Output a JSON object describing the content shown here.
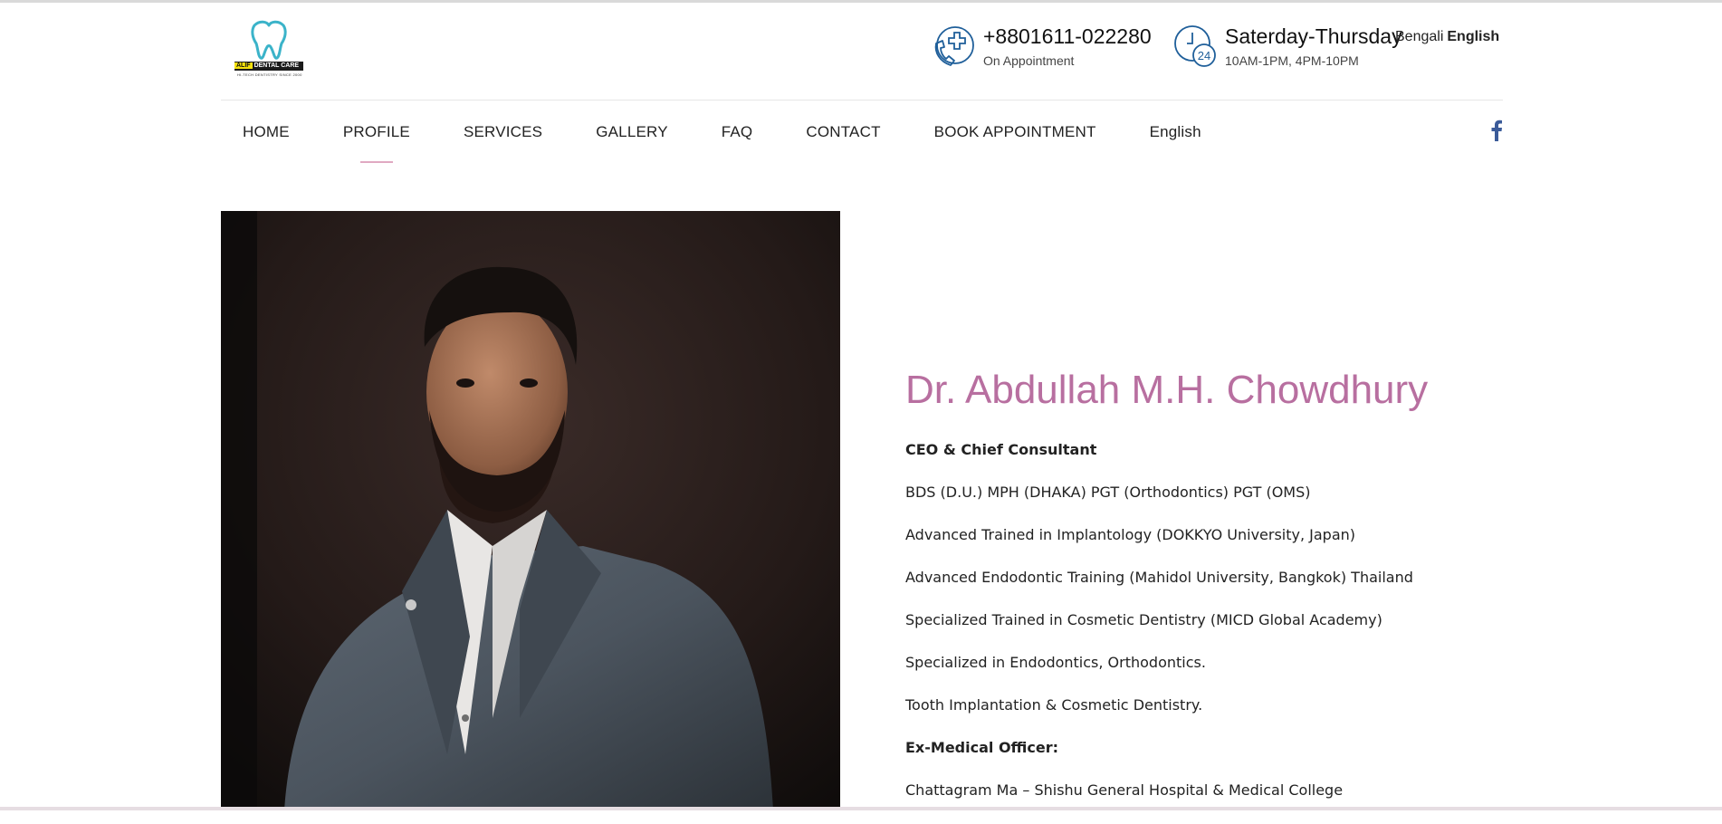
{
  "header": {
    "logo": {
      "brand_highlight": "ALIF",
      "brand_rest": "DENTAL CARE",
      "tagline": "HI-TECH DENTISTRY SINCE 2000"
    },
    "phone": {
      "icon": "phone-medical-icon",
      "number": "+8801611-022280",
      "note": "On Appointment"
    },
    "hours": {
      "icon": "clock-24-icon",
      "days": "Saterday-Thursday",
      "times": "10AM-1PM, 4PM-10PM"
    },
    "language": {
      "option_bengali": "Bengali",
      "option_english": "English",
      "selected": "English"
    }
  },
  "nav": {
    "items": [
      {
        "label": "HOME"
      },
      {
        "label": "PROFILE",
        "active": true
      },
      {
        "label": "SERVICES"
      },
      {
        "label": "GALLERY"
      },
      {
        "label": "FAQ"
      },
      {
        "label": "CONTACT"
      },
      {
        "label": "BOOK APPOINTMENT"
      },
      {
        "label": "English"
      }
    ],
    "social_icon": "facebook-icon"
  },
  "profile": {
    "name": "Dr. Abdullah M.H. Chowdhury",
    "lines": [
      {
        "text": "CEO & Chief Consultant",
        "bold": true
      },
      {
        "text": "BDS (D.U.) MPH (DHAKA) PGT (Orthodontics) PGT (OMS)"
      },
      {
        "text": "Advanced Trained in Implantology (DOKKYO University, Japan)"
      },
      {
        "text": "Advanced Endodontic Training (Mahidol University, Bangkok) Thailand"
      },
      {
        "text": "Specialized Trained in Cosmetic Dentistry (MICD Global Academy)"
      },
      {
        "text": "Specialized in Endodontics, Orthodontics."
      },
      {
        "text": "Tooth Implantation & Cosmetic Dentistry."
      },
      {
        "text": "Ex-Medical Officer:",
        "bold": true
      },
      {
        "text": "Chattagram Ma – Shishu General Hospital & Medical College"
      }
    ]
  },
  "colors": {
    "accent": "#b86fa0",
    "nav_underline": "#e0a9c2",
    "icon_blue": "#1f5f9a",
    "logo_teal": "#3bb3c9"
  }
}
